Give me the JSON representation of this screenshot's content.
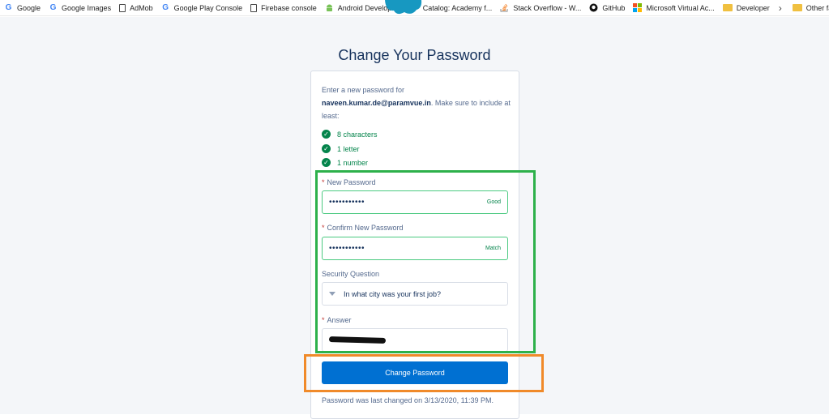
{
  "bookmarks": {
    "items": [
      {
        "label": "Google",
        "icon": "google-g-icon"
      },
      {
        "label": "Google Images",
        "icon": "google-g-icon"
      },
      {
        "label": "AdMob",
        "icon": "document-icon"
      },
      {
        "label": "Google Play Console",
        "icon": "google-g-icon"
      },
      {
        "label": "Firebase console",
        "icon": "document-icon"
      },
      {
        "label": "Android Developers",
        "icon": "android-icon"
      },
      {
        "label": "Catalog: Academy f...",
        "icon": "play-arrow-icon"
      },
      {
        "label": "Stack Overflow - W...",
        "icon": "stackoverflow-icon"
      },
      {
        "label": "GitHub",
        "icon": "github-icon"
      },
      {
        "label": "Microsoft Virtual Ac...",
        "icon": "microsoft-icon"
      },
      {
        "label": "Developer",
        "icon": "folder-icon"
      }
    ],
    "overflow_label": "Other favorites",
    "chevron": "›"
  },
  "page": {
    "title": "Change Your Password",
    "intro_prefix": "Enter a new password for",
    "email": "naveen.kumar.de@paramvue.in",
    "intro_suffix": ". Make sure to include at least:",
    "requirements": [
      {
        "label": "8 characters",
        "check": "✓"
      },
      {
        "label": "1 letter",
        "check": "✓"
      },
      {
        "label": "1 number",
        "check": "✓"
      }
    ]
  },
  "form": {
    "required_marker": "*",
    "new_password": {
      "label": "New Password",
      "value": "•••••••••••",
      "strength": "Good"
    },
    "confirm_password": {
      "label": "Confirm New Password",
      "value": "•••••••••••",
      "strength": "Match"
    },
    "security_question": {
      "label": "Security Question",
      "selected": "In what city was your first job?"
    },
    "answer": {
      "label": "Answer"
    },
    "submit_label": "Change Password",
    "last_changed": "Password was last changed on 3/13/2020, 11:39 PM."
  },
  "colors": {
    "primary": "#0070d2",
    "success": "#04844b",
    "highlight_green": "#2db14b",
    "highlight_orange": "#f08a2a"
  }
}
